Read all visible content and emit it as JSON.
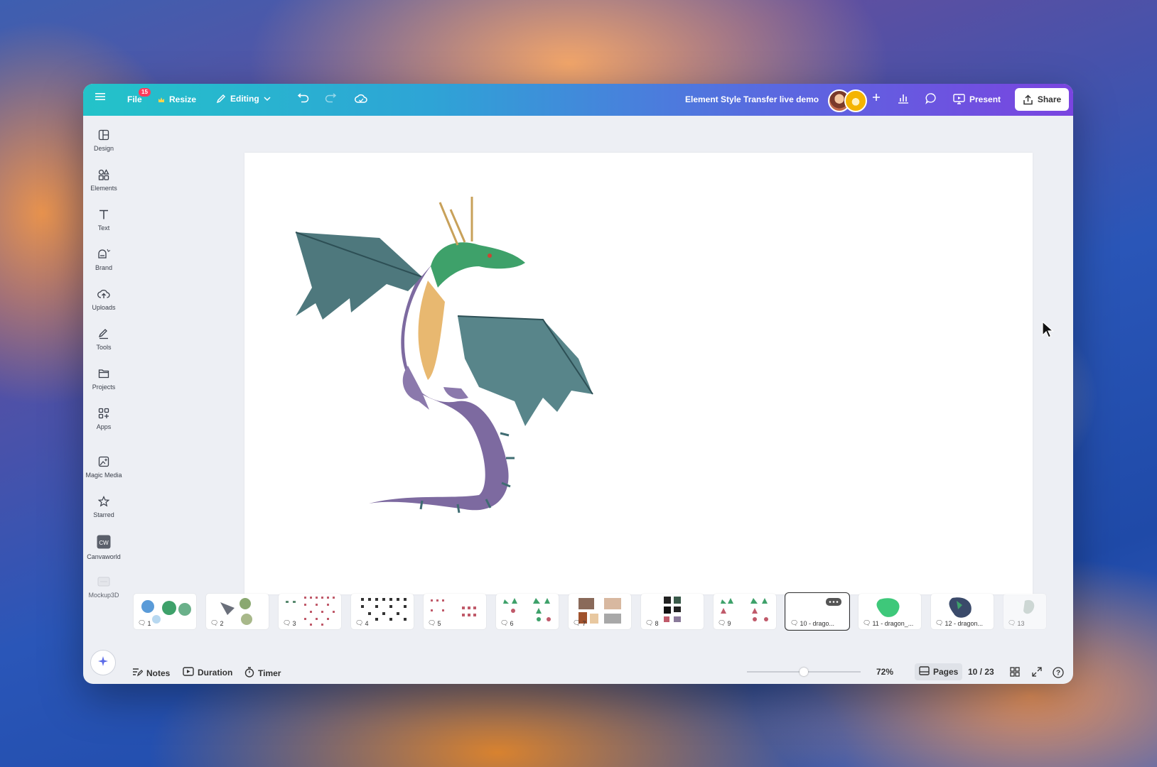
{
  "topbar": {
    "file_label": "File",
    "file_badge": "15",
    "resize_label": "Resize",
    "editing_label": "Editing",
    "document_title": "Element Style Transfer live demo",
    "present_label": "Present",
    "share_label": "Share"
  },
  "sidebar": {
    "items": [
      {
        "label": "Design",
        "icon": "design-icon"
      },
      {
        "label": "Elements",
        "icon": "elements-icon"
      },
      {
        "label": "Text",
        "icon": "text-icon"
      },
      {
        "label": "Brand",
        "icon": "brand-icon"
      },
      {
        "label": "Uploads",
        "icon": "uploads-icon"
      },
      {
        "label": "Tools",
        "icon": "tools-icon"
      },
      {
        "label": "Projects",
        "icon": "projects-icon"
      },
      {
        "label": "Apps",
        "icon": "apps-icon"
      },
      {
        "label": "Magic Media",
        "icon": "magic-media-icon"
      },
      {
        "label": "Starred",
        "icon": "star-icon"
      },
      {
        "label": "Canvaworld",
        "icon": "canvaworld-icon"
      },
      {
        "label": "Mockup3D",
        "icon": "mockup3d-icon"
      }
    ]
  },
  "pages": {
    "thumbs": [
      {
        "label": "1"
      },
      {
        "label": "2"
      },
      {
        "label": "3"
      },
      {
        "label": "4"
      },
      {
        "label": "5"
      },
      {
        "label": "6"
      },
      {
        "label": "7"
      },
      {
        "label": "8"
      },
      {
        "label": "9"
      },
      {
        "label": "10 - drago..."
      },
      {
        "label": "11 - dragon_..."
      },
      {
        "label": "12 - dragon..."
      },
      {
        "label": "13"
      }
    ],
    "active_index": 10
  },
  "bottombar": {
    "notes_label": "Notes",
    "duration_label": "Duration",
    "timer_label": "Timer",
    "zoom": "72%",
    "zoom_level": 0.5,
    "pages_label": "Pages",
    "page_counter": "10 / 23"
  },
  "colors": {
    "topbar_start": "#23c3c9",
    "topbar_end": "#7a44e0",
    "badge": "#ff3b5c"
  }
}
